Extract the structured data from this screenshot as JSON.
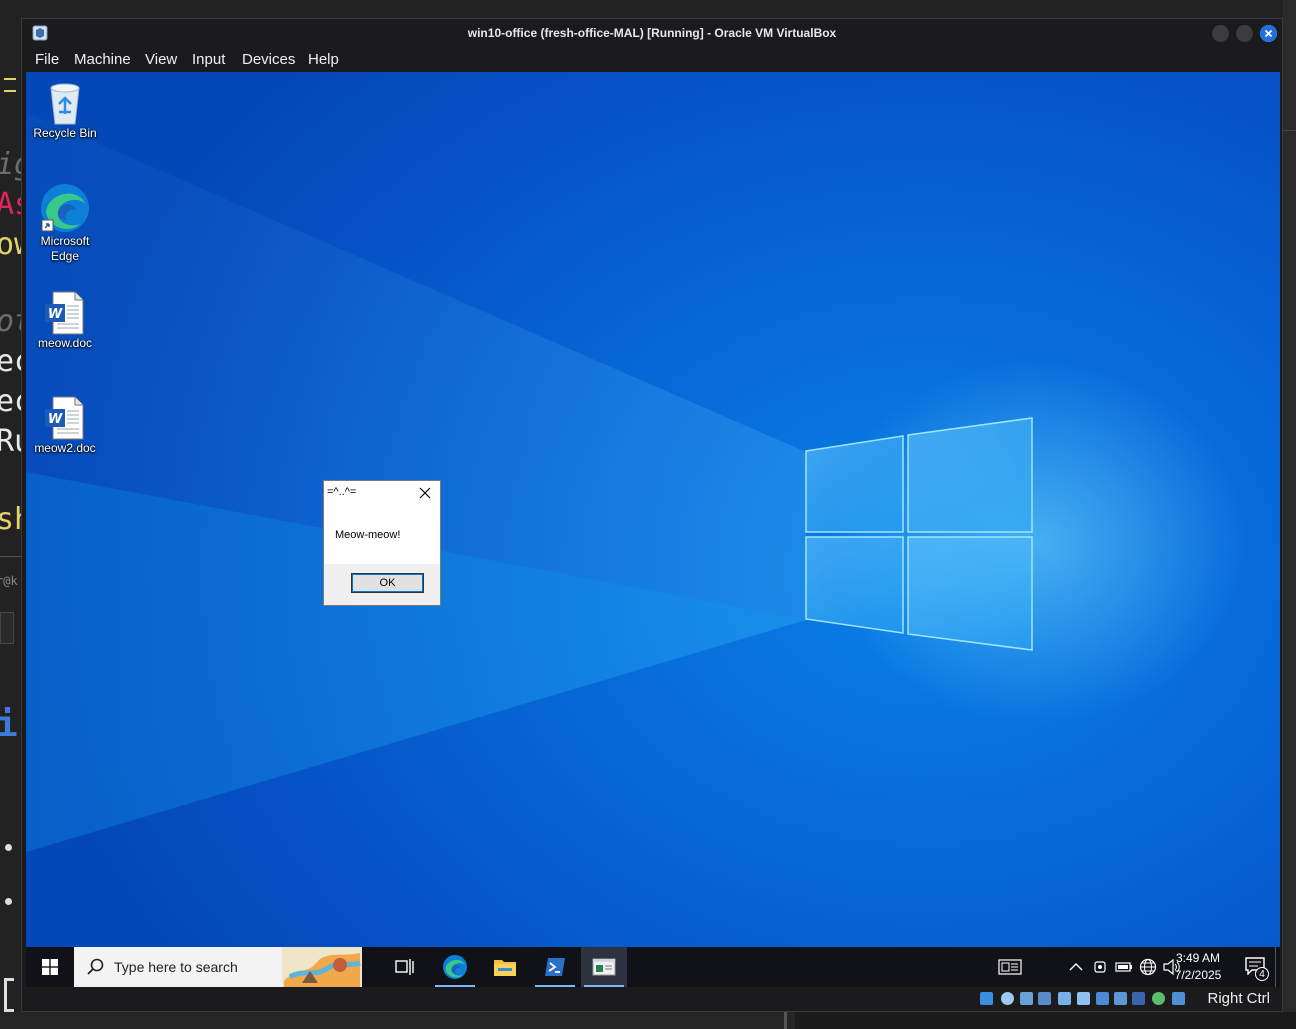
{
  "window": {
    "title": "win10-office (fresh-office-MAL) [Running] - Oracle VM VirtualBox"
  },
  "menubar": {
    "items": [
      "File",
      "Machine",
      "View",
      "Input",
      "Devices",
      "Help"
    ]
  },
  "desktop": {
    "icons": [
      {
        "label": "Recycle Bin",
        "icon": "recycle-bin-icon"
      },
      {
        "label": "Microsoft Edge",
        "icon": "edge-icon"
      },
      {
        "label": "meow.doc",
        "icon": "word-document-icon"
      },
      {
        "label": "meow2.doc",
        "icon": "word-document-icon"
      }
    ]
  },
  "message_box": {
    "title": "=^..^=",
    "text": "Meow-meow!",
    "ok_label": "OK"
  },
  "taskbar": {
    "search_placeholder": "Type here to search",
    "pinned": [
      "task-view-icon",
      "edge-icon",
      "file-explorer-icon",
      "powershell-icon",
      "active-window-icon"
    ],
    "tray": {
      "time": "3:49 AM",
      "date": "7/2/2025",
      "notification_count": "4"
    }
  },
  "statusbar": {
    "host_key": "Right Ctrl"
  },
  "host_background_fragments": [
    "ig",
    "As",
    "ow",
    "ot",
    "ec",
    "ec",
    "Ru",
    "sh",
    "r@k",
    "i"
  ]
}
